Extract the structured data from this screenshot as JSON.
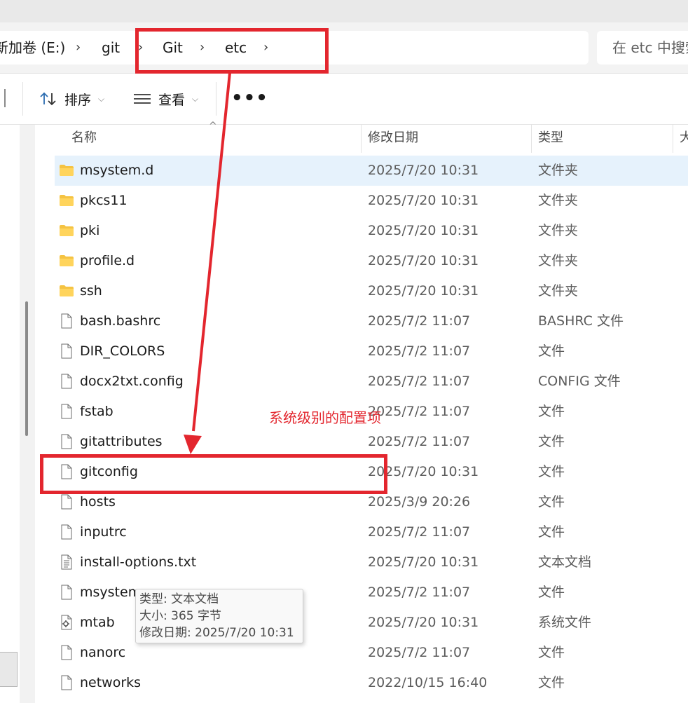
{
  "breadcrumb": {
    "items": [
      "新加卷 (E:)",
      "git",
      "Git",
      "etc"
    ],
    "separator": "›"
  },
  "search": {
    "placeholder": "在 etc 中搜索"
  },
  "toolbar": {
    "sort_label": "排序",
    "view_label": "查看",
    "more_label": "•••"
  },
  "columns": {
    "name": "名称",
    "date": "修改日期",
    "type": "类型",
    "size": "大"
  },
  "files": [
    {
      "name": "msystem.d",
      "date": "2025/7/20 10:31",
      "type": "文件夹",
      "icon": "folder-icon",
      "selected": true
    },
    {
      "name": "pkcs11",
      "date": "2025/7/20 10:31",
      "type": "文件夹",
      "icon": "folder-icon"
    },
    {
      "name": "pki",
      "date": "2025/7/20 10:31",
      "type": "文件夹",
      "icon": "folder-icon"
    },
    {
      "name": "profile.d",
      "date": "2025/7/20 10:31",
      "type": "文件夹",
      "icon": "folder-icon"
    },
    {
      "name": "ssh",
      "date": "2025/7/20 10:31",
      "type": "文件夹",
      "icon": "folder-icon"
    },
    {
      "name": "bash.bashrc",
      "date": "2025/7/2 11:07",
      "type": "BASHRC 文件",
      "icon": "file-icon"
    },
    {
      "name": "DIR_COLORS",
      "date": "2025/7/2 11:07",
      "type": "文件",
      "icon": "file-icon"
    },
    {
      "name": "docx2txt.config",
      "date": "2025/7/2 11:07",
      "type": "CONFIG 文件",
      "icon": "file-icon"
    },
    {
      "name": "fstab",
      "date": "2025/7/2 11:07",
      "type": "文件",
      "icon": "file-icon"
    },
    {
      "name": "gitattributes",
      "date": "2025/7/2 11:07",
      "type": "文件",
      "icon": "file-icon"
    },
    {
      "name": "gitconfig",
      "date": "2025/7/20 10:31",
      "type": "文件",
      "icon": "file-icon"
    },
    {
      "name": "hosts",
      "date": "2025/3/9 20:26",
      "type": "文件",
      "icon": "file-icon"
    },
    {
      "name": "inputrc",
      "date": "2025/7/2 11:07",
      "type": "文件",
      "icon": "file-icon"
    },
    {
      "name": "install-options.txt",
      "date": "2025/7/20 10:31",
      "type": "文本文档",
      "icon": "text-file-icon"
    },
    {
      "name": "msystem",
      "date": "2025/7/2 11:07",
      "type": "文件",
      "icon": "file-icon"
    },
    {
      "name": "mtab",
      "date": "2025/7/20 10:31",
      "type": "系统文件",
      "icon": "system-file-icon"
    },
    {
      "name": "nanorc",
      "date": "2025/7/2 11:07",
      "type": "文件",
      "icon": "file-icon"
    },
    {
      "name": "networks",
      "date": "2022/10/15 16:40",
      "type": "文件",
      "icon": "file-icon"
    }
  ],
  "tooltip": {
    "type_line": "类型: 文本文档",
    "size_line": "大小: 365 字节",
    "date_line": "修改日期: 2025/7/20 10:31"
  },
  "annotation": {
    "label": "系统级别的配置项",
    "color": "#e3262e"
  },
  "colors": {
    "selected_row": "#e6f2fc",
    "folder": "#f5c342",
    "annotation": "#e3262e"
  }
}
